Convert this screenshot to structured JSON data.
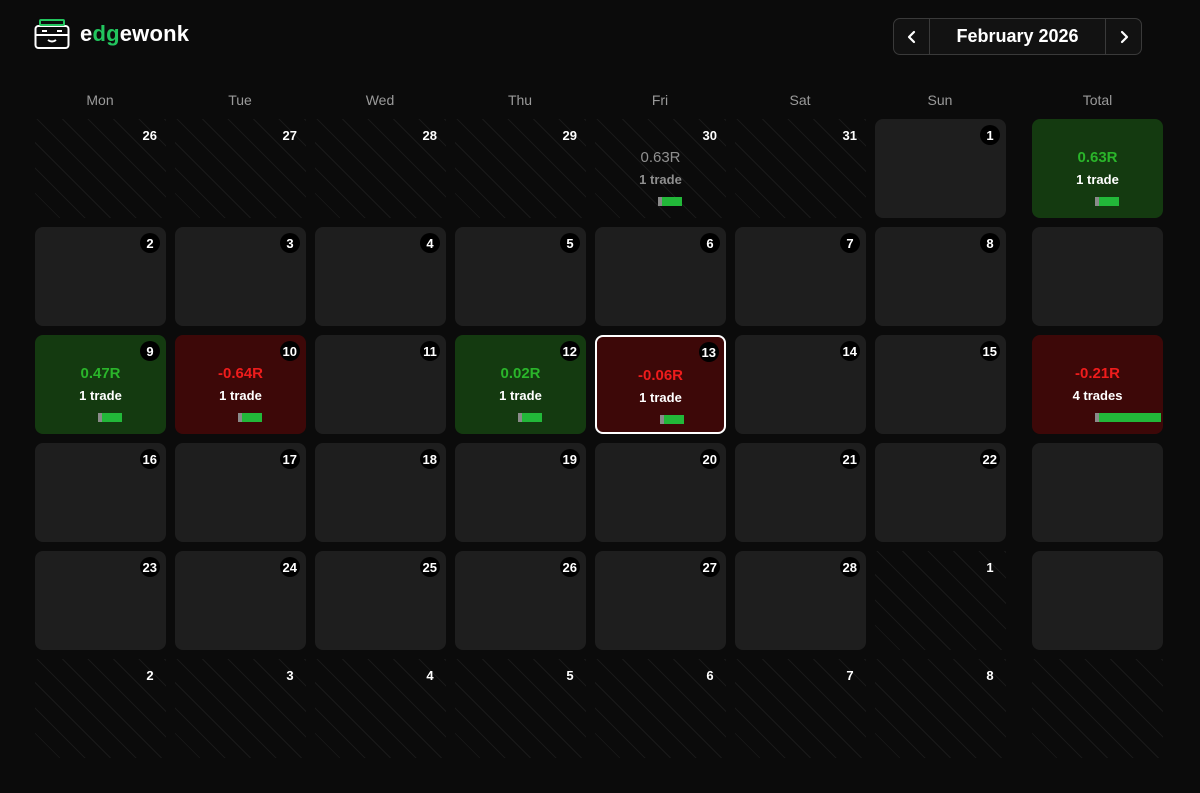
{
  "app": {
    "logo_prefix": "e",
    "logo_accent": "dg",
    "logo_suffix": "ewonk"
  },
  "nav": {
    "month_label": "February 2026"
  },
  "weekdays": [
    "Mon",
    "Tue",
    "Wed",
    "Thu",
    "Fri",
    "Sat",
    "Sun",
    "Total"
  ],
  "weeks": [
    {
      "days": [
        {
          "day": "26",
          "type": "out"
        },
        {
          "day": "27",
          "type": "out"
        },
        {
          "day": "28",
          "type": "out"
        },
        {
          "day": "29",
          "type": "out"
        },
        {
          "day": "30",
          "type": "out",
          "pnl": "0.63R",
          "trades": "1 trade",
          "trade_count": 1
        },
        {
          "day": "31",
          "type": "out"
        },
        {
          "day": "1",
          "type": "in"
        }
      ],
      "total": {
        "pnl": "0.63R",
        "trades": "1 trade",
        "result": "win",
        "trade_count": 1
      }
    },
    {
      "days": [
        {
          "day": "2",
          "type": "in"
        },
        {
          "day": "3",
          "type": "in"
        },
        {
          "day": "4",
          "type": "in"
        },
        {
          "day": "5",
          "type": "in"
        },
        {
          "day": "6",
          "type": "in"
        },
        {
          "day": "7",
          "type": "in"
        },
        {
          "day": "8",
          "type": "in"
        }
      ],
      "total": {}
    },
    {
      "days": [
        {
          "day": "9",
          "type": "in",
          "result": "win",
          "pnl": "0.47R",
          "trades": "1 trade",
          "trade_count": 1
        },
        {
          "day": "10",
          "type": "in",
          "result": "loss",
          "pnl": "-0.64R",
          "trades": "1 trade",
          "trade_count": 1
        },
        {
          "day": "11",
          "type": "in"
        },
        {
          "day": "12",
          "type": "in",
          "result": "win",
          "pnl": "0.02R",
          "trades": "1 trade",
          "trade_count": 1
        },
        {
          "day": "13",
          "type": "in",
          "result": "loss",
          "selected": true,
          "pnl": "-0.06R",
          "trades": "1 trade",
          "trade_count": 1
        },
        {
          "day": "14",
          "type": "in"
        },
        {
          "day": "15",
          "type": "in"
        }
      ],
      "total": {
        "pnl": "-0.21R",
        "trades": "4 trades",
        "result": "loss",
        "trade_count": 4
      }
    },
    {
      "days": [
        {
          "day": "16",
          "type": "in"
        },
        {
          "day": "17",
          "type": "in"
        },
        {
          "day": "18",
          "type": "in"
        },
        {
          "day": "19",
          "type": "in"
        },
        {
          "day": "20",
          "type": "in"
        },
        {
          "day": "21",
          "type": "in"
        },
        {
          "day": "22",
          "type": "in"
        }
      ],
      "total": {}
    },
    {
      "days": [
        {
          "day": "23",
          "type": "in"
        },
        {
          "day": "24",
          "type": "in"
        },
        {
          "day": "25",
          "type": "in"
        },
        {
          "day": "26",
          "type": "in"
        },
        {
          "day": "27",
          "type": "in"
        },
        {
          "day": "28",
          "type": "in"
        },
        {
          "day": "1",
          "type": "out"
        }
      ],
      "total": {}
    },
    {
      "days": [
        {
          "day": "2",
          "type": "out"
        },
        {
          "day": "3",
          "type": "out"
        },
        {
          "day": "4",
          "type": "out"
        },
        {
          "day": "5",
          "type": "out"
        },
        {
          "day": "6",
          "type": "out"
        },
        {
          "day": "7",
          "type": "out"
        },
        {
          "day": "8",
          "type": "out"
        }
      ],
      "total": {
        "type": "out"
      }
    }
  ],
  "colors": {
    "win_bg": "#143a10",
    "loss_bg": "#3d0808",
    "positive": "#2ab52a",
    "negative": "#ef1c1c",
    "accent": "#22c55e"
  }
}
